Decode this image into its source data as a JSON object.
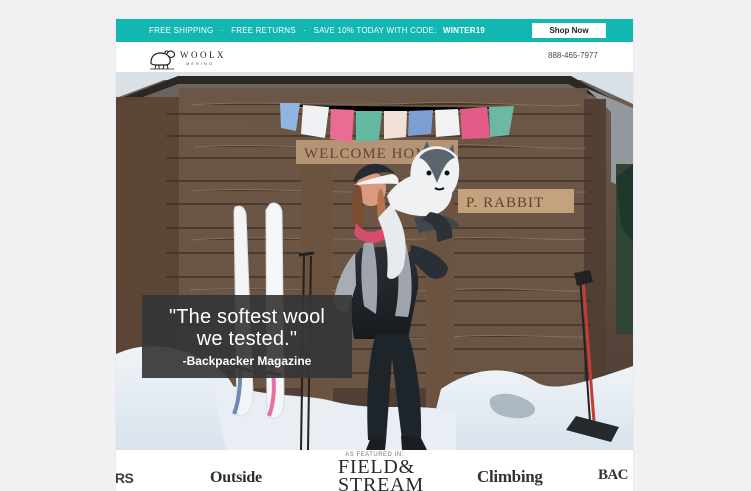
{
  "announcement": {
    "shipping_text": "FREE SHIPPING",
    "returns_text": "FREE RETURNS",
    "save_text": "SAVE 10% TODAY WITH CODE:",
    "code": "WINTER19",
    "shop_now_label": "Shop Now"
  },
  "header": {
    "logo_word": "WOOLX",
    "logo_sub": "MERINO",
    "phone": "888-465-7977"
  },
  "hero": {
    "quote": "\"The softest wool\nwe tested.\"",
    "source": "-Backpacker Magazine",
    "image_icon": "photo-icon"
  },
  "featured": {
    "label": "AS FEATURED IN:",
    "brands": [
      "ERS",
      "Outside",
      "FIELD&\nSTREAM",
      "Climbing",
      "BAC"
    ]
  },
  "colors": {
    "teal": "#11b7b0",
    "dark_overlay": "#363636"
  }
}
